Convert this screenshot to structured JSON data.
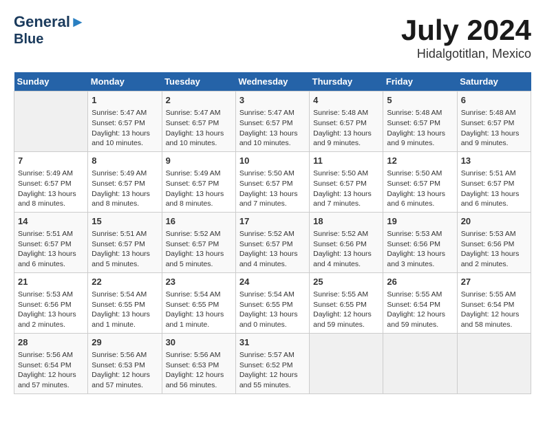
{
  "header": {
    "logo_line1": "General",
    "logo_line2": "Blue",
    "title": "July 2024",
    "subtitle": "Hidalgotitlan, Mexico"
  },
  "days_of_week": [
    "Sunday",
    "Monday",
    "Tuesday",
    "Wednesday",
    "Thursday",
    "Friday",
    "Saturday"
  ],
  "weeks": [
    [
      {
        "day": "",
        "info": ""
      },
      {
        "day": "1",
        "info": "Sunrise: 5:47 AM\nSunset: 6:57 PM\nDaylight: 13 hours\nand 10 minutes."
      },
      {
        "day": "2",
        "info": "Sunrise: 5:47 AM\nSunset: 6:57 PM\nDaylight: 13 hours\nand 10 minutes."
      },
      {
        "day": "3",
        "info": "Sunrise: 5:47 AM\nSunset: 6:57 PM\nDaylight: 13 hours\nand 10 minutes."
      },
      {
        "day": "4",
        "info": "Sunrise: 5:48 AM\nSunset: 6:57 PM\nDaylight: 13 hours\nand 9 minutes."
      },
      {
        "day": "5",
        "info": "Sunrise: 5:48 AM\nSunset: 6:57 PM\nDaylight: 13 hours\nand 9 minutes."
      },
      {
        "day": "6",
        "info": "Sunrise: 5:48 AM\nSunset: 6:57 PM\nDaylight: 13 hours\nand 9 minutes."
      }
    ],
    [
      {
        "day": "7",
        "info": "Sunrise: 5:49 AM\nSunset: 6:57 PM\nDaylight: 13 hours\nand 8 minutes."
      },
      {
        "day": "8",
        "info": "Sunrise: 5:49 AM\nSunset: 6:57 PM\nDaylight: 13 hours\nand 8 minutes."
      },
      {
        "day": "9",
        "info": "Sunrise: 5:49 AM\nSunset: 6:57 PM\nDaylight: 13 hours\nand 8 minutes."
      },
      {
        "day": "10",
        "info": "Sunrise: 5:50 AM\nSunset: 6:57 PM\nDaylight: 13 hours\nand 7 minutes."
      },
      {
        "day": "11",
        "info": "Sunrise: 5:50 AM\nSunset: 6:57 PM\nDaylight: 13 hours\nand 7 minutes."
      },
      {
        "day": "12",
        "info": "Sunrise: 5:50 AM\nSunset: 6:57 PM\nDaylight: 13 hours\nand 6 minutes."
      },
      {
        "day": "13",
        "info": "Sunrise: 5:51 AM\nSunset: 6:57 PM\nDaylight: 13 hours\nand 6 minutes."
      }
    ],
    [
      {
        "day": "14",
        "info": "Sunrise: 5:51 AM\nSunset: 6:57 PM\nDaylight: 13 hours\nand 6 minutes."
      },
      {
        "day": "15",
        "info": "Sunrise: 5:51 AM\nSunset: 6:57 PM\nDaylight: 13 hours\nand 5 minutes."
      },
      {
        "day": "16",
        "info": "Sunrise: 5:52 AM\nSunset: 6:57 PM\nDaylight: 13 hours\nand 5 minutes."
      },
      {
        "day": "17",
        "info": "Sunrise: 5:52 AM\nSunset: 6:57 PM\nDaylight: 13 hours\nand 4 minutes."
      },
      {
        "day": "18",
        "info": "Sunrise: 5:52 AM\nSunset: 6:56 PM\nDaylight: 13 hours\nand 4 minutes."
      },
      {
        "day": "19",
        "info": "Sunrise: 5:53 AM\nSunset: 6:56 PM\nDaylight: 13 hours\nand 3 minutes."
      },
      {
        "day": "20",
        "info": "Sunrise: 5:53 AM\nSunset: 6:56 PM\nDaylight: 13 hours\nand 2 minutes."
      }
    ],
    [
      {
        "day": "21",
        "info": "Sunrise: 5:53 AM\nSunset: 6:56 PM\nDaylight: 13 hours\nand 2 minutes."
      },
      {
        "day": "22",
        "info": "Sunrise: 5:54 AM\nSunset: 6:55 PM\nDaylight: 13 hours\nand 1 minute."
      },
      {
        "day": "23",
        "info": "Sunrise: 5:54 AM\nSunset: 6:55 PM\nDaylight: 13 hours\nand 1 minute."
      },
      {
        "day": "24",
        "info": "Sunrise: 5:54 AM\nSunset: 6:55 PM\nDaylight: 13 hours\nand 0 minutes."
      },
      {
        "day": "25",
        "info": "Sunrise: 5:55 AM\nSunset: 6:55 PM\nDaylight: 12 hours\nand 59 minutes."
      },
      {
        "day": "26",
        "info": "Sunrise: 5:55 AM\nSunset: 6:54 PM\nDaylight: 12 hours\nand 59 minutes."
      },
      {
        "day": "27",
        "info": "Sunrise: 5:55 AM\nSunset: 6:54 PM\nDaylight: 12 hours\nand 58 minutes."
      }
    ],
    [
      {
        "day": "28",
        "info": "Sunrise: 5:56 AM\nSunset: 6:54 PM\nDaylight: 12 hours\nand 57 minutes."
      },
      {
        "day": "29",
        "info": "Sunrise: 5:56 AM\nSunset: 6:53 PM\nDaylight: 12 hours\nand 57 minutes."
      },
      {
        "day": "30",
        "info": "Sunrise: 5:56 AM\nSunset: 6:53 PM\nDaylight: 12 hours\nand 56 minutes."
      },
      {
        "day": "31",
        "info": "Sunrise: 5:57 AM\nSunset: 6:52 PM\nDaylight: 12 hours\nand 55 minutes."
      },
      {
        "day": "",
        "info": ""
      },
      {
        "day": "",
        "info": ""
      },
      {
        "day": "",
        "info": ""
      }
    ]
  ]
}
